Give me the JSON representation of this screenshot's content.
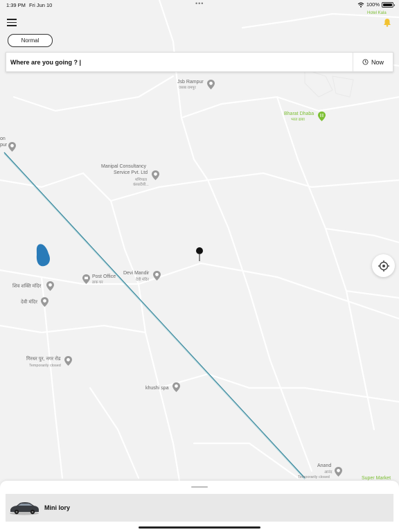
{
  "status_bar": {
    "time": "1:39 PM",
    "date": "Fri Jun 10",
    "battery": "100%"
  },
  "header": {
    "mode_button": "Normal"
  },
  "search": {
    "placeholder": "Where are you going ? |",
    "now_label": "Now"
  },
  "map": {
    "pois": [
      {
        "name": "Jsb Rampur",
        "sub": "जसब रामपुर"
      },
      {
        "name": "Bharat Dhaba",
        "sub": "भरत ढाबा"
      },
      {
        "name": "Manipal Consultancy",
        "name2": "Service Pvt. Ltd",
        "sub": "मणिपाल",
        "sub2": "कंसल्टेंसी..."
      },
      {
        "name": "on",
        "name2": "pur"
      },
      {
        "name": "Post Office",
        "sub": "डाक घर"
      },
      {
        "name": "Devi Mandir",
        "sub": "देवी मंदिर"
      },
      {
        "name": "शिव शक्ति मंदिर"
      },
      {
        "name": "देवी मंदिर"
      },
      {
        "name": "गिरधर पुर, नगर रोड",
        "sub": "Temporarily closed"
      },
      {
        "name": "khushi spa"
      },
      {
        "name": "Anand",
        "sub": "आनंद",
        "sub2": "Temporarily closed"
      },
      {
        "name": "Super Market"
      },
      {
        "name": "Hotel Kala"
      }
    ],
    "colors": {
      "background": "#f2f2f2",
      "road": "#ffffff",
      "water": "#2a7bb8",
      "railway": "#3a8a9e",
      "poi_gray": "#999999",
      "poi_green": "#7cbf33"
    }
  },
  "icons": {
    "menu": "hamburger-icon",
    "notification": "bell-icon",
    "clock": "clock-icon",
    "locate": "crosshair-icon",
    "pin": "map-pin-icon"
  },
  "bottom_sheet": {
    "vehicle_label": "Mini lory"
  }
}
